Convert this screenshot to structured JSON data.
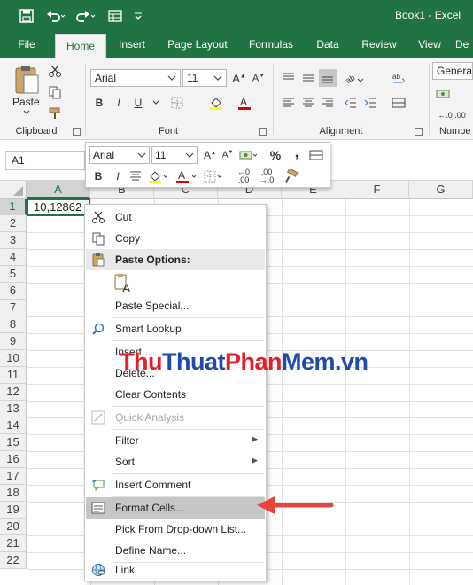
{
  "app": {
    "document_title": "Book1 - Excel",
    "accent": "#217346"
  },
  "tabs": [
    {
      "label": "File"
    },
    {
      "label": "Home",
      "active": true
    },
    {
      "label": "Insert"
    },
    {
      "label": "Page Layout"
    },
    {
      "label": "Formulas"
    },
    {
      "label": "Data"
    },
    {
      "label": "Review"
    },
    {
      "label": "View"
    },
    {
      "label": "De"
    }
  ],
  "ribbon": {
    "clipboard": {
      "label": "Clipboard",
      "paste_label": "Paste"
    },
    "font": {
      "label": "Font",
      "name": "Arial",
      "size": "11",
      "bold": "B",
      "italic": "I",
      "underline": "U"
    },
    "alignment": {
      "label": "Alignment"
    },
    "number": {
      "label": "Numbe",
      "format": "General"
    }
  },
  "formula_bar": {
    "name_box": "A1"
  },
  "grid": {
    "columns": [
      "A",
      "B",
      "C",
      "D",
      "E",
      "F",
      "G"
    ],
    "rows": [
      "1",
      "2",
      "3",
      "4",
      "5",
      "6",
      "7",
      "8",
      "9",
      "10",
      "11",
      "12",
      "13",
      "14",
      "15",
      "16",
      "17",
      "18",
      "19",
      "20",
      "21",
      "22"
    ],
    "cell_a1": "10,12862"
  },
  "mini_toolbar": {
    "font_name": "Arial",
    "font_size": "11",
    "percent": "%",
    "comma": ",",
    "bold": "B",
    "italic": "I"
  },
  "context_menu": {
    "items": [
      {
        "label": "Cut",
        "icon": "scissors-icon"
      },
      {
        "label": "Copy",
        "icon": "copy-icon"
      },
      {
        "label": "Paste Options:",
        "icon": "clipboard-icon",
        "header": true
      },
      {
        "label": "",
        "icon": "paste-option-icon"
      },
      {
        "label": "Paste Special..."
      },
      {
        "label": "Smart Lookup",
        "icon": "search-icon"
      },
      {
        "label": "Insert..."
      },
      {
        "label": "Delete..."
      },
      {
        "label": "Clear Contents"
      },
      {
        "label": "Quick Analysis",
        "icon": "quick-analysis-icon",
        "disabled": true
      },
      {
        "label": "Filter",
        "submenu": true
      },
      {
        "label": "Sort",
        "submenu": true
      },
      {
        "label": "Insert Comment",
        "icon": "comment-icon"
      },
      {
        "label": "Format Cells...",
        "icon": "format-cells-icon",
        "highlight": true
      },
      {
        "label": "Pick From Drop-down List..."
      },
      {
        "label": "Define Name..."
      },
      {
        "label": "Link",
        "icon": "link-icon"
      }
    ]
  },
  "watermark": {
    "part1": "Thu",
    "part2": "Thuat",
    "part3": "Phan",
    "part4": "Mem",
    "part5": ".vn"
  }
}
